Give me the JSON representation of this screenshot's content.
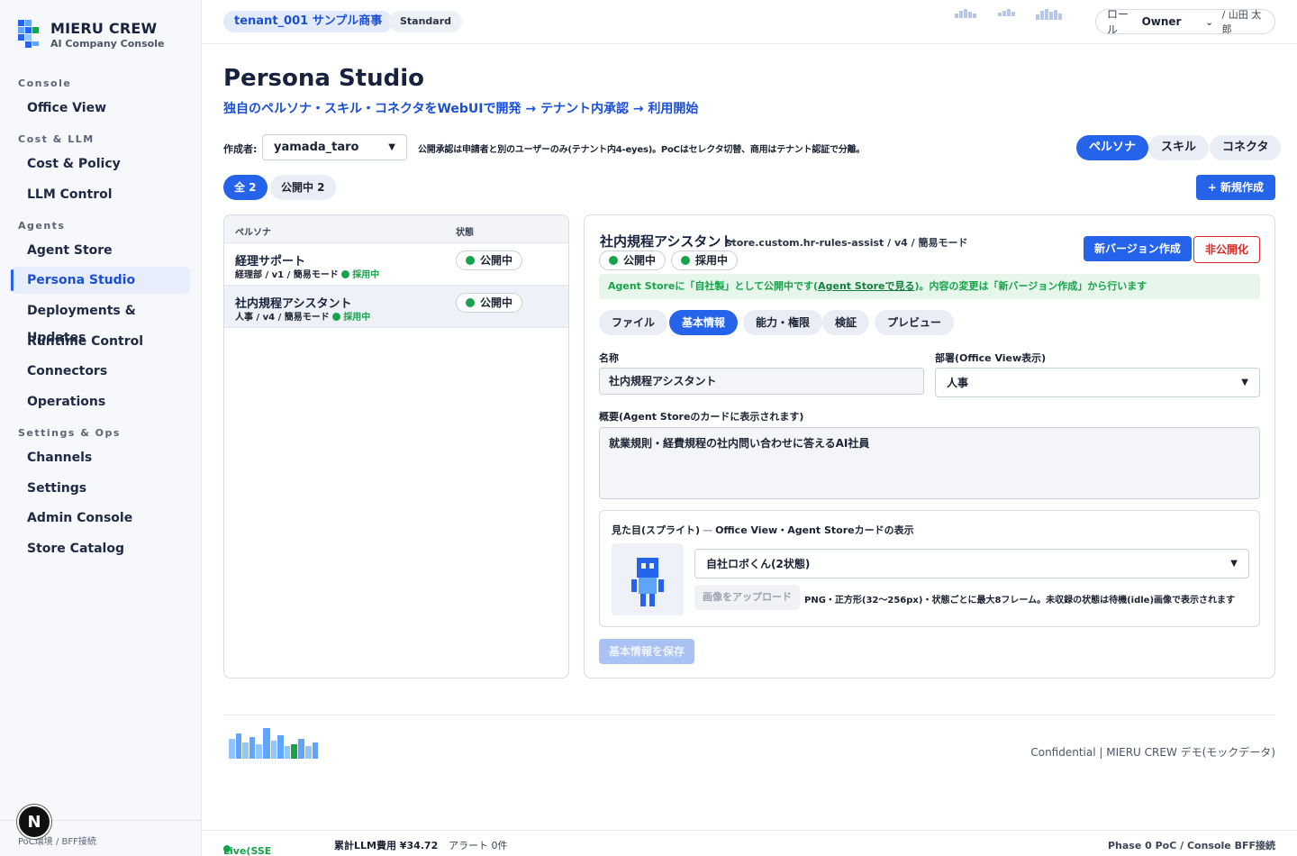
{
  "brand": {
    "name": "MIERU CREW",
    "subtitle": "AI Company Console"
  },
  "sidebar": {
    "sections": [
      "Console",
      "Cost & LLM",
      "Agents",
      "Settings & Ops"
    ],
    "items": [
      {
        "label": "Office View"
      },
      {
        "label": "Cost & Policy"
      },
      {
        "label": "LLM Control"
      },
      {
        "label": "Agent Store"
      },
      {
        "label": "Persona Studio",
        "active": true
      },
      {
        "label": "Deployments & Updates"
      },
      {
        "label": "Runtime Control"
      },
      {
        "label": "Connectors"
      },
      {
        "label": "Operations"
      },
      {
        "label": "Channels"
      },
      {
        "label": "Settings"
      },
      {
        "label": "Admin Console"
      },
      {
        "label": "Store Catalog"
      }
    ],
    "footer": "PoC環境 / BFF接続",
    "avatar_letter": "N"
  },
  "topbar": {
    "tenant": "tenant_001 サンプル商事",
    "plan": "Standard",
    "role_label": "ロール",
    "role_value": "Owner",
    "user": "/ 山田 太郎"
  },
  "page": {
    "title": "Persona Studio",
    "subtitle": "独自のペルソナ・スキル・コネクタをWebUIで開発 → テナント内承認 → 利用開始",
    "author_label": "作成者:",
    "author_value": "yamada_taro",
    "author_note": "公開承認は申請者と別のユーザーのみ(テナント内4-eyes)。PoCはセレクタ切替、商用はテナント認証で分離。",
    "segments": [
      "ペルソナ",
      "スキル",
      "コネクタ"
    ],
    "filters": [
      "全 2",
      "公開中 2"
    ],
    "new_button": "+ 新規作成"
  },
  "list": {
    "headers": {
      "persona": "ペルソナ",
      "status": "状態"
    },
    "rows": [
      {
        "name": "経理サポート",
        "meta": "経理部 / v1 / 簡易モード",
        "adopt": "採用中",
        "status": "公開中"
      },
      {
        "name": "社内規程アシスタント",
        "meta": "人事 / v4 / 簡易モード",
        "adopt": "採用中",
        "status": "公開中"
      }
    ]
  },
  "detail": {
    "title": "社内規程アシスタント",
    "id": "store.custom.hr-rules-assist / v4 / 簡易モード",
    "chips": [
      "公開中",
      "採用中"
    ],
    "new_version_button": "新バージョン作成",
    "unpublish_button": "非公開化",
    "banner_pre": "Agent Storeに「自社製」として公開中です(",
    "banner_link": "Agent Storeで見る",
    "banner_post": ")。内容の変更は「新バージョン作成」から行います",
    "tabs": [
      "ファイル",
      "基本情報",
      "能力・権限",
      "検証",
      "プレビュー"
    ],
    "name_label": "名称",
    "name_value": "社内規程アシスタント",
    "dept_label": "部署(Office View表示)",
    "dept_value": "人事",
    "summary_label": "概要(Agent Storeのカードに表示されます)",
    "summary_value": "就業規則・経費規程の社内問い合わせに答えるAI社員",
    "sprite_label": "見た目(スプライト)",
    "sprite_label_sep": "—",
    "sprite_label_note": "Office View・Agent Storeカードの表示",
    "sprite_select": "自社ロボくん(2状態)",
    "upload_button": "画像をアップロード",
    "upload_note": "PNG・正方形(32〜256px)・状態ごとに最大8フレーム。未収録の状態は待機(idle)画像で表示されます",
    "save_button": "基本情報を保存"
  },
  "footer": {
    "confidential": "Confidential | MIERU CREW デモ(モックデータ)"
  },
  "statusbar": {
    "live": "Live(SSE接続中)",
    "cost": "累計LLM費用 ¥34.72",
    "alerts": "アラート 0件",
    "phase": "Phase 0 PoC / Console BFF接続"
  },
  "colors": {
    "accent": "#2563eb",
    "success": "#16a34a",
    "danger": "#dc2626",
    "sidebar_bg": "#f7f8fc"
  }
}
